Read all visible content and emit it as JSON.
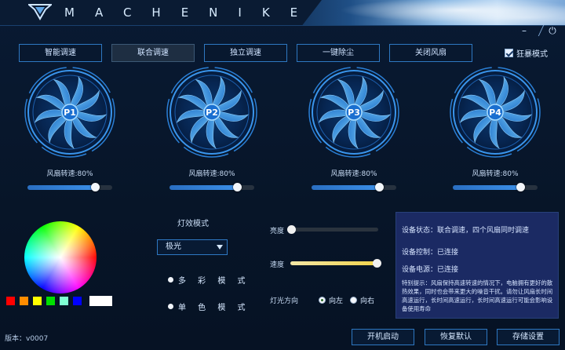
{
  "window": {
    "brand": "MACHENIKE",
    "controls": {
      "minimize": "–",
      "power": "⏻"
    }
  },
  "modes": [
    {
      "label": "智能调速",
      "active": false
    },
    {
      "label": "联合调速",
      "active": true
    },
    {
      "label": "独立调速",
      "active": false
    },
    {
      "label": "一键除尘",
      "active": false
    },
    {
      "label": "关闭风扇",
      "active": false
    }
  ],
  "crazy_mode": {
    "label": "狂暴模式",
    "checked": true
  },
  "fans": [
    {
      "id": "P1",
      "label": "风扇转速:80%",
      "speed": 0.8
    },
    {
      "id": "P2",
      "label": "风扇转速:80%",
      "speed": 0.8
    },
    {
      "id": "P3",
      "label": "风扇转速:80%",
      "speed": 0.8
    },
    {
      "id": "P4",
      "label": "风扇转速:80%",
      "speed": 0.8
    }
  ],
  "light": {
    "mode_label": "灯效模式",
    "selected_effect": "极光",
    "multi_color": "多 彩 模 式",
    "single_color": "单 色 模 式",
    "swatches": [
      "#ff0000",
      "#ff8c00",
      "#ffff00",
      "#00e000",
      "#7fffd4",
      "#0000ff",
      "#ffffff"
    ],
    "brightness_label": "亮度",
    "brightness": 0.0,
    "speed_label": "速度",
    "speed": 1.0,
    "direction_label": "灯光方向",
    "dir_left": "向左",
    "dir_right": "向右",
    "direction": "left"
  },
  "info": {
    "status": "设备状态：联合调速，四个风扇同时调速",
    "control": "设备控制：已连接",
    "power": "设备电源：已连接",
    "tip": "特别提示：风扇保持高速转速的情况下，电脑拥有更好的散热效果，同时也会带来更大的噪音干扰。请勿让风扇长时间高速运行，长时间高速运行，长时间高速运行可能会影响设备使用寿命"
  },
  "version": "版本：v0007",
  "buttons": {
    "autostart": "开机启动",
    "restore": "恢复默认",
    "save": "存储设置"
  },
  "colors": {
    "accent": "#2e78c2",
    "panel": "#1b2a63",
    "background": "#061326"
  }
}
